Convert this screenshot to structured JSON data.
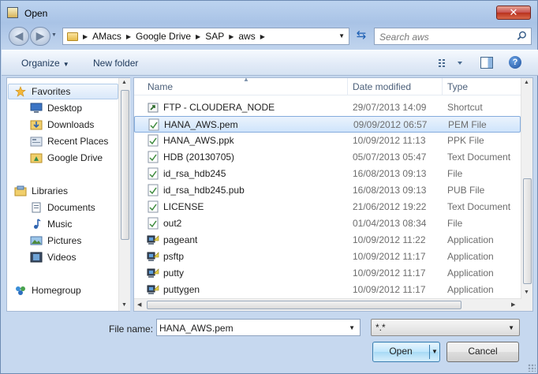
{
  "window": {
    "title": "Open",
    "close_label": "✕"
  },
  "address": {
    "crumbs": [
      "AMacs",
      "Google Drive",
      "SAP",
      "aws"
    ]
  },
  "search": {
    "placeholder": "Search aws"
  },
  "toolbar": {
    "organize_label": "Organize",
    "new_folder_label": "New folder"
  },
  "nav": {
    "favorites_label": "Favorites",
    "favorites": [
      "Desktop",
      "Downloads",
      "Recent Places",
      "Google Drive"
    ],
    "libraries_label": "Libraries",
    "libraries": [
      "Documents",
      "Music",
      "Pictures",
      "Videos"
    ],
    "homegroup_label": "Homegroup"
  },
  "columns": {
    "name": "Name",
    "date": "Date modified",
    "type": "Type"
  },
  "files": [
    {
      "name": "FTP -  CLOUDERA_NODE",
      "date": "29/07/2013 14:09",
      "type": "Shortcut",
      "icon": "shortcut-icon"
    },
    {
      "name": "HANA_AWS.pem",
      "date": "09/09/2012 06:57",
      "type": "PEM File",
      "icon": "file-icon"
    },
    {
      "name": "HANA_AWS.ppk",
      "date": "10/09/2012 11:13",
      "type": "PPK File",
      "icon": "file-icon"
    },
    {
      "name": "HDB (20130705)",
      "date": "05/07/2013 05:47",
      "type": "Text Document",
      "icon": "file-icon"
    },
    {
      "name": "id_rsa_hdb245",
      "date": "16/08/2013 09:13",
      "type": "File",
      "icon": "file-icon"
    },
    {
      "name": "id_rsa_hdb245.pub",
      "date": "16/08/2013 09:13",
      "type": "PUB File",
      "icon": "file-icon"
    },
    {
      "name": "LICENSE",
      "date": "21/06/2012 19:22",
      "type": "Text Document",
      "icon": "file-icon"
    },
    {
      "name": "out2",
      "date": "01/04/2013 08:34",
      "type": "File",
      "icon": "file-icon"
    },
    {
      "name": "pageant",
      "date": "10/09/2012 11:22",
      "type": "Application",
      "icon": "app-icon"
    },
    {
      "name": "psftp",
      "date": "10/09/2012 11:17",
      "type": "Application",
      "icon": "app-icon"
    },
    {
      "name": "putty",
      "date": "10/09/2012 11:17",
      "type": "Application",
      "icon": "app-icon"
    },
    {
      "name": "puttygen",
      "date": "10/09/2012 11:17",
      "type": "Application",
      "icon": "app-icon"
    }
  ],
  "selected_index": 1,
  "bottom": {
    "file_name_label": "File name:",
    "file_name_value": "HANA_AWS.pem",
    "file_type_value": "*.*",
    "open_label": "Open",
    "cancel_label": "Cancel"
  }
}
